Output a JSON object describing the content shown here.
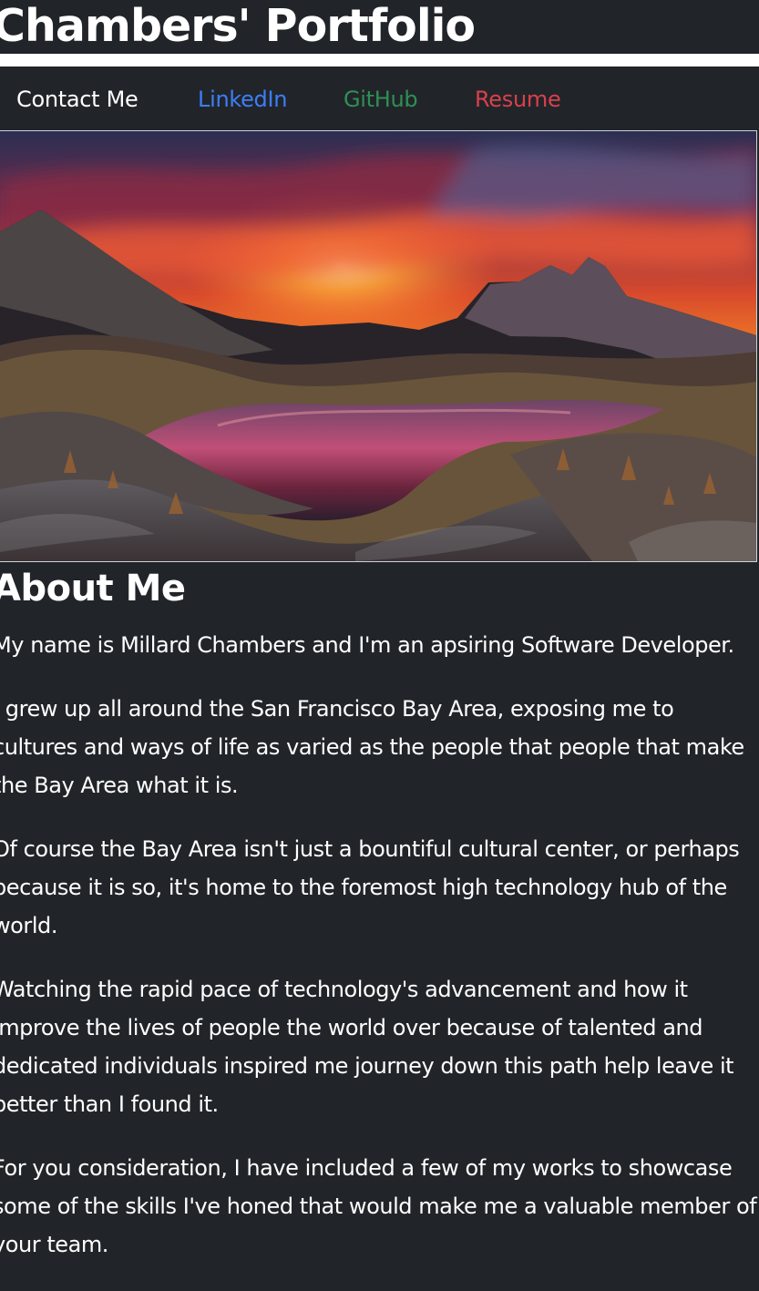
{
  "header": {
    "title": "Chambers' Portfolio"
  },
  "nav": {
    "items": [
      {
        "label": "Contact Me",
        "color": "#ffffff"
      },
      {
        "label": "LinkedIn",
        "color": "#3d7ef7"
      },
      {
        "label": "GitHub",
        "color": "#2f8f55"
      },
      {
        "label": "Resume",
        "color": "#d9404d"
      }
    ]
  },
  "hero": {
    "description": "Mountain lake at sunset"
  },
  "about": {
    "heading": "About Me",
    "paragraphs": [
      "My name is Millard Chambers and I'm an apsiring Software Developer.",
      "I grew up all around the San Francisco Bay Area, exposing me to cultures and ways of life as varied as the people that people that make the Bay Area what it is.",
      "Of course the Bay Area isn't just a bountiful cultural center, or perhaps because it is so, it's home to the foremost high technology hub of the world.",
      "Watching the rapid pace of technology's advancement and how it improve the lives of people the world over because of talented and dedicated individuals inspired me journey down this path help leave it better than I found it.",
      "For you consideration, I have included a few of my works to showcase some of the skills I've honed that would make me a valuable member of your team."
    ]
  },
  "colors": {
    "background": "#212529",
    "text": "#ffffff"
  }
}
